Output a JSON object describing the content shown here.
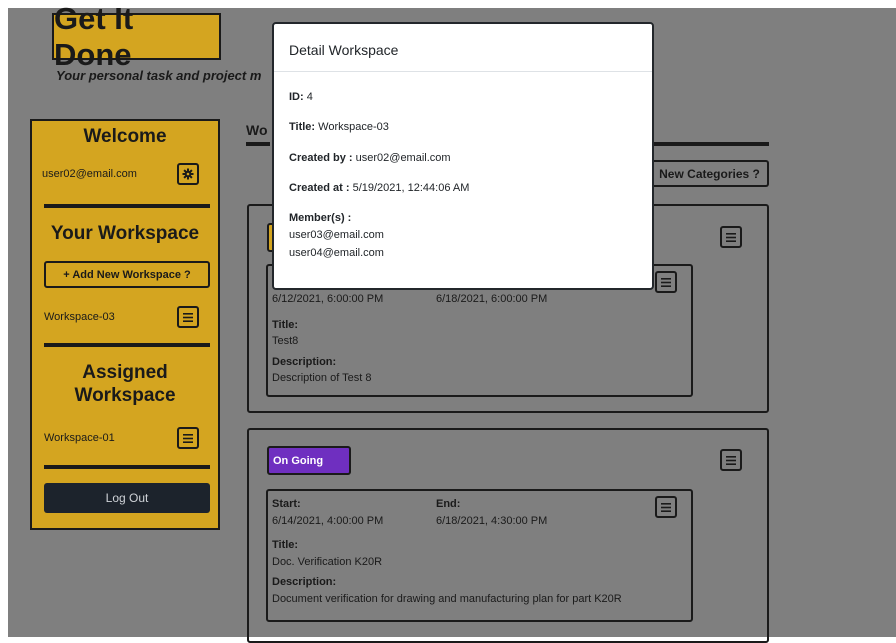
{
  "app": {
    "title": "Get It Done",
    "tagline": "Your personal task and project m"
  },
  "sidebar": {
    "welcome_title": "Welcome",
    "user_email": "user02@email.com",
    "your_workspace_title": "Your Workspace",
    "add_workspace_label": "+ Add New Workspace ?",
    "your_workspaces": [
      {
        "label": "Workspace-03"
      }
    ],
    "assigned_title_line1": "Assigned",
    "assigned_title_line2": "Workspace",
    "assigned_workspaces": [
      {
        "label": "Workspace-01"
      }
    ],
    "logout_label": "Log Out"
  },
  "main": {
    "tab_label": "Wo",
    "new_categories_label": "New Categories ?",
    "categories": [
      {
        "status": "",
        "status_color": "#d4a520",
        "task": {
          "start_value": "6/12/2021, 6:00:00 PM",
          "end_value": "6/18/2021, 6:00:00 PM",
          "title_label": "Title:",
          "title_value": "Test8",
          "description_label": "Description:",
          "description_value": "Description of Test 8"
        }
      },
      {
        "status": "On Going",
        "status_color": "#6f2fc0",
        "task": {
          "start_label": "Start:",
          "start_value": "6/14/2021, 4:00:00 PM",
          "end_label": "End:",
          "end_value": "6/18/2021, 4:30:00 PM",
          "title_label": "Title:",
          "title_value": "Doc. Verification K20R",
          "description_label": "Description:",
          "description_value": "Document verification for drawing and manufacturing plan for part K20R"
        }
      }
    ]
  },
  "modal": {
    "title": "Detail Workspace",
    "id_label": "ID:",
    "id_value": "4",
    "title_label": "Title:",
    "title_value": "Workspace-03",
    "created_by_label": "Created by :",
    "created_by_value": "user02@email.com",
    "created_at_label": "Created at :",
    "created_at_value": "5/19/2021, 12:44:06 AM",
    "members_label": "Member(s) :",
    "members": [
      "user03@email.com",
      "user04@email.com"
    ]
  },
  "colors": {
    "accent": "#d4a520",
    "dark": "#1c232c",
    "ongoing": "#6f2fc0",
    "backdrop": "#7f7f7f"
  },
  "icons": {
    "settings": "gear-icon",
    "menu": "hamburger-icon"
  }
}
